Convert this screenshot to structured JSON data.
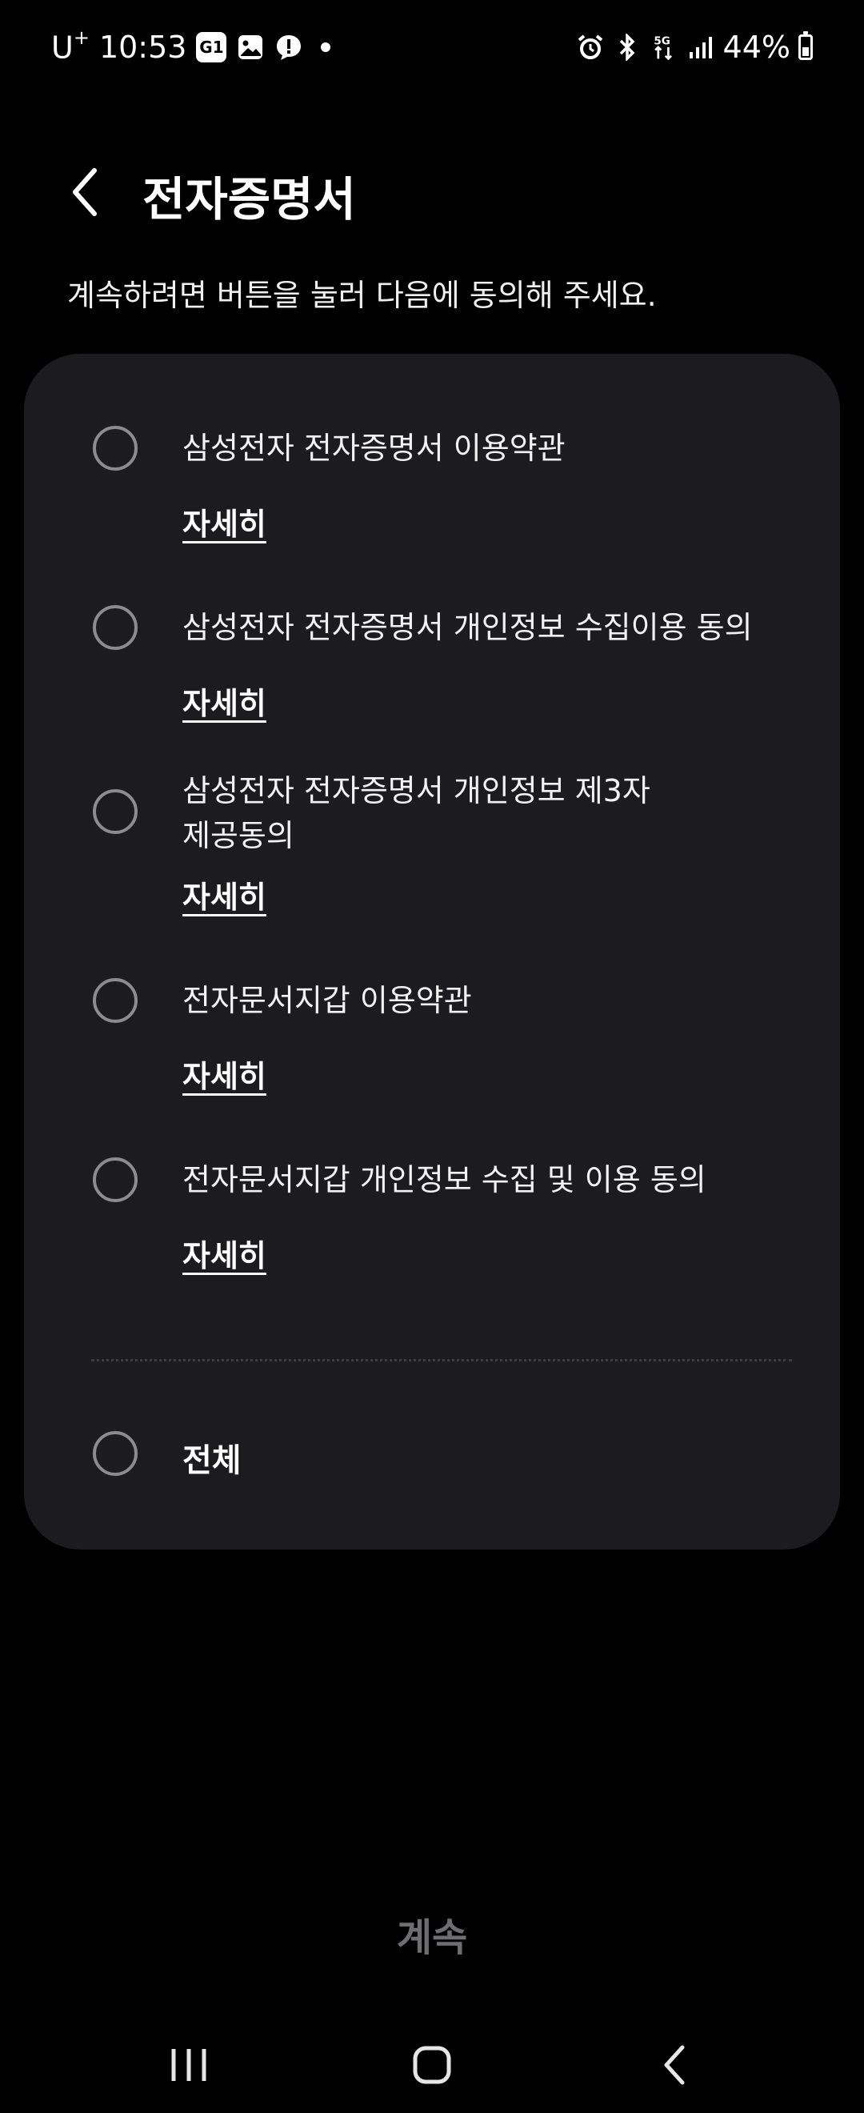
{
  "status_bar": {
    "carrier": "U",
    "carrier_sup": "+",
    "time": "10:53",
    "notif_1": "G1",
    "battery": "44%",
    "icons": [
      "gallery-icon",
      "message-alert-icon",
      "alarm-icon",
      "bluetooth-icon",
      "5g-icon",
      "signal-icon",
      "battery-icon"
    ]
  },
  "header": {
    "title": "전자증명서"
  },
  "subtitle": "계속하려면 버튼을 눌러 다음에 동의해 주세요.",
  "agreements": [
    {
      "label": "삼성전자 전자증명서 이용약관",
      "details": "자세히",
      "checked": false
    },
    {
      "label": "삼성전자 전자증명서 개인정보 수집이용 동의",
      "details": "자세히",
      "checked": false
    },
    {
      "label_line1": "삼성전자 전자증명서 개인정보 제3자",
      "label_line2": "제공동의",
      "details": "자세히",
      "checked": false
    },
    {
      "label": "전자문서지갑 이용약관",
      "details": "자세히",
      "checked": false
    },
    {
      "label": "전자문서지갑 개인정보 수집 및 이용 동의",
      "details": "자세히",
      "checked": false
    }
  ],
  "all": {
    "label": "전체",
    "checked": false
  },
  "continue_label": "계속",
  "colors": {
    "background": "#000000",
    "card": "#1c1c1e",
    "radio_border": "#8c8c8c",
    "continue_disabled": "#6e6e70"
  }
}
